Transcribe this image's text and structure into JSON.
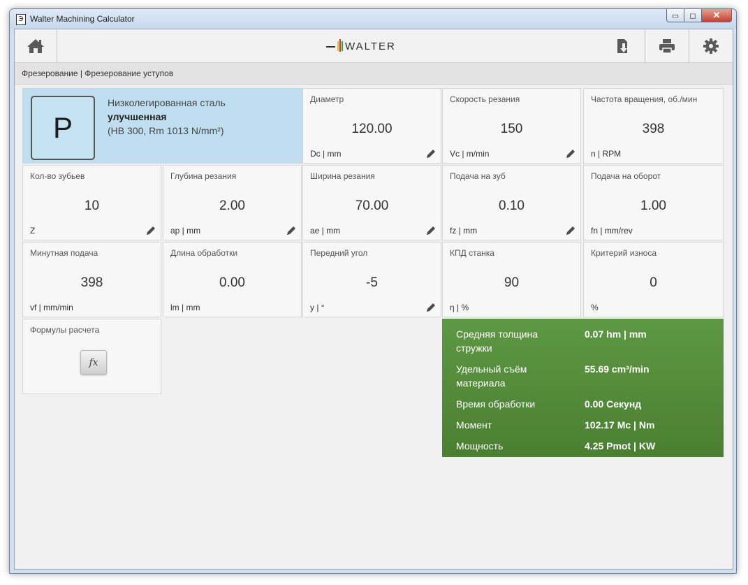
{
  "window": {
    "title": "Walter Machining Calculator",
    "app_icon_glyph": "Э",
    "minimize_glyph": "▭",
    "maximize_glyph": "◻",
    "close_glyph": "✕"
  },
  "toolbar": {
    "logo_text": "WALTER",
    "icons": [
      "home-icon",
      "import-icon",
      "print-icon",
      "gear-icon"
    ]
  },
  "breadcrumb": "Фрезерование | Фрезерование уступов",
  "material": {
    "group_letter": "P",
    "line1": "Низколегированная сталь",
    "line2": "улучшенная",
    "line3": "(HB 300, Rm 1013 N/mm²)"
  },
  "params": [
    {
      "label": "Диаметр",
      "value": "120.00",
      "unit": "Dc | mm",
      "editable": true
    },
    {
      "label": "Скорость резания",
      "value": "150",
      "unit": "Vc | m/min",
      "editable": true
    },
    {
      "label": "Частота вращения, об./мин",
      "value": "398",
      "unit": "n | RPM",
      "editable": false
    },
    {
      "label": "Кол-во зубьев",
      "value": "10",
      "unit": "Z",
      "editable": true
    },
    {
      "label": "Глубина резания",
      "value": "2.00",
      "unit": "ap | mm",
      "editable": true
    },
    {
      "label": "Ширина резания",
      "value": "70.00",
      "unit": "ae | mm",
      "editable": true
    },
    {
      "label": "Подача на зуб",
      "value": "0.10",
      "unit": "fz | mm",
      "editable": true
    },
    {
      "label": "Подача на оборот",
      "value": "1.00",
      "unit": "fn | mm/rev",
      "editable": false
    },
    {
      "label": "Минутная подача",
      "value": "398",
      "unit": "vf | mm/min",
      "editable": false
    },
    {
      "label": "Длина обработки",
      "value": "0.00",
      "unit": "lm | mm",
      "editable": false
    },
    {
      "label": "Передний угол",
      "value": "-5",
      "unit": "y | °",
      "editable": true
    },
    {
      "label": "КПД станка",
      "value": "90",
      "unit": "η | %",
      "editable": false
    },
    {
      "label": "Критерий износа",
      "value": "0",
      "unit": "%",
      "editable": false
    }
  ],
  "formulas": {
    "label": "Формулы расчета",
    "button": "fx"
  },
  "results": [
    {
      "label": "Средняя толщина стружки",
      "value": "0.07 hm | mm"
    },
    {
      "label": "Удельный съём материала",
      "value": "55.69 cm³/min"
    },
    {
      "label": "Время обработки",
      "value": "0.00 Секунд"
    },
    {
      "label": "Момент",
      "value": "102.17 Mc | Nm"
    },
    {
      "label": "Мощность",
      "value": "4.25 Pmot | KW"
    }
  ],
  "colors": {
    "material_bg": "#bfdff0",
    "results_bg": "#5a923f",
    "logo_bar_yellow": "#e6c020",
    "logo_bar_red": "#d23a2a",
    "logo_bar_green": "#4a9a3a"
  }
}
